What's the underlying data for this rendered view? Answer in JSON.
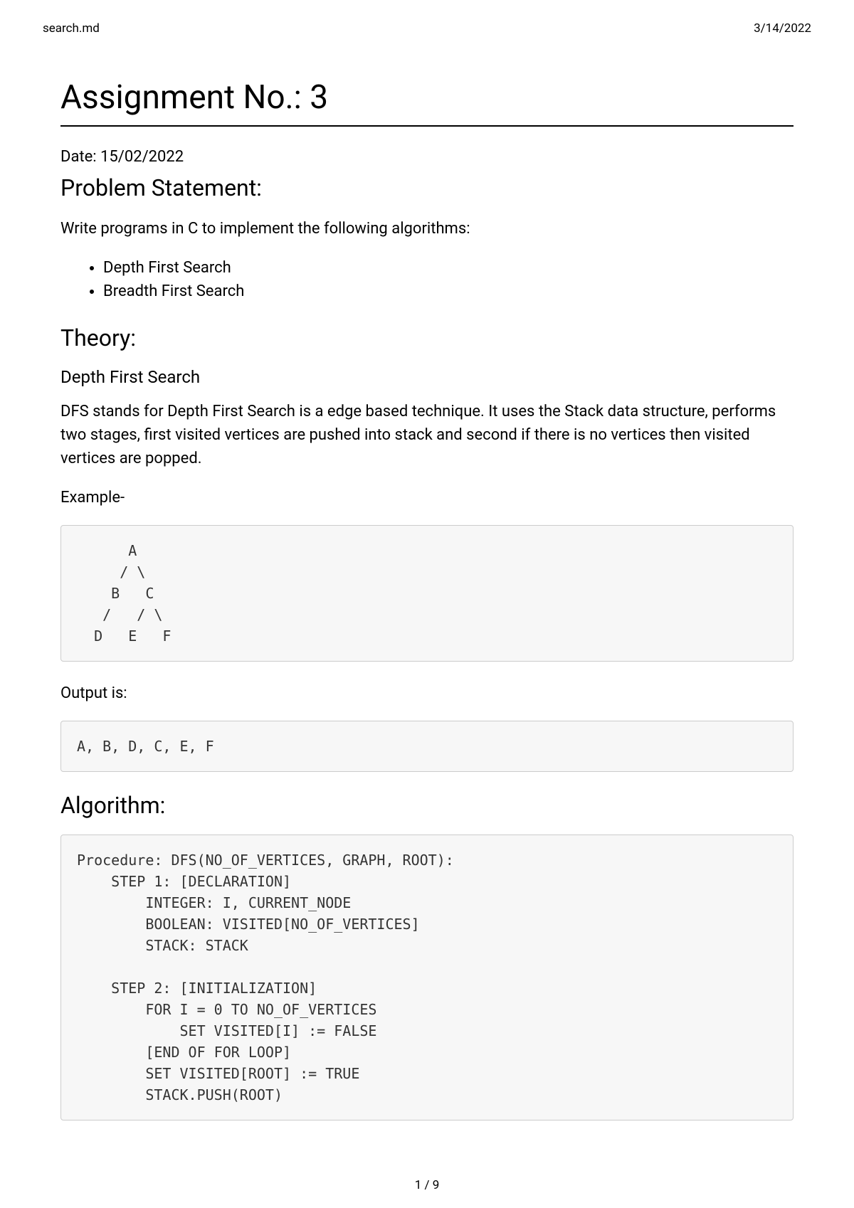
{
  "header": {
    "filename": "search.md",
    "date": "3/14/2022"
  },
  "title": "Assignment No.: 3",
  "date_line": "Date: 15/02/2022",
  "section_problem_statement": "Problem Statement:",
  "problem_intro": "Write programs in C to implement the following algorithms:",
  "algorithms": [
    "Depth First Search",
    "Breadth First Search"
  ],
  "section_theory": "Theory:",
  "dfs_heading": "Depth First Search",
  "dfs_description": "DFS stands for Depth First Search is a edge based technique. It uses the Stack data structure, performs two stages, first visited vertices are pushed into stack and second if there is no vertices then visited vertices are popped.",
  "example_label": "Example-",
  "tree_diagram": "      A\n     / \\\n    B   C\n   /   / \\\n  D   E   F",
  "output_label": "Output is:",
  "output_text": "A, B, D, C, E, F",
  "section_algorithm": "Algorithm:",
  "algorithm_code": "Procedure: DFS(NO_OF_VERTICES, GRAPH, ROOT):\n    STEP 1: [DECLARATION]\n        INTEGER: I, CURRENT_NODE\n        BOOLEAN: VISITED[NO_OF_VERTICES]\n        STACK: STACK\n\n    STEP 2: [INITIALIZATION]\n        FOR I = 0 TO NO_OF_VERTICES\n            SET VISITED[I] := FALSE\n        [END OF FOR LOOP]\n        SET VISITED[ROOT] := TRUE\n        STACK.PUSH(ROOT)",
  "footer": {
    "page_indicator": "1 / 9"
  }
}
